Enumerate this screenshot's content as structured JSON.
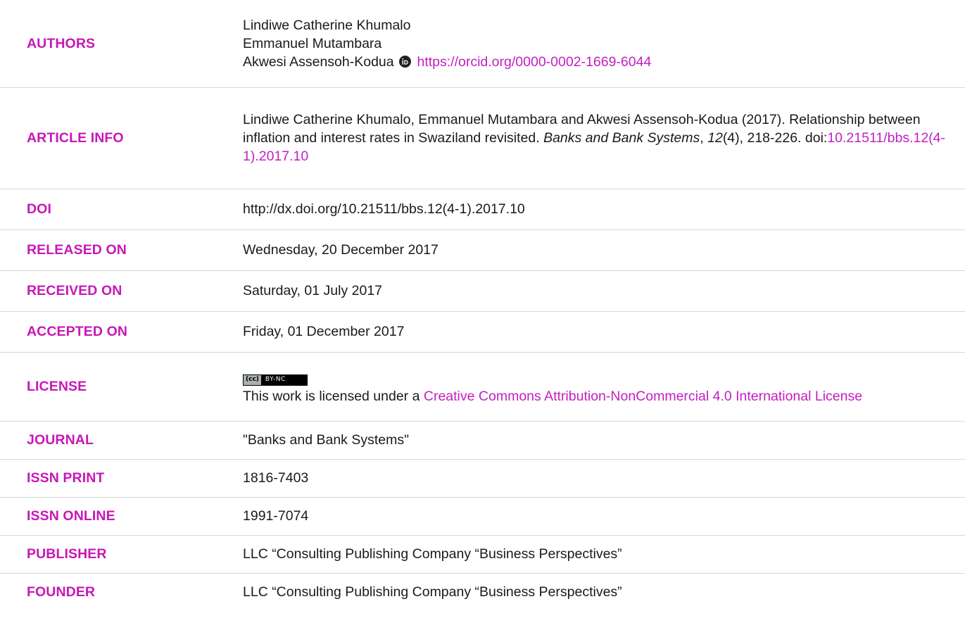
{
  "rows": {
    "authors": {
      "label": "AUTHORS",
      "names": [
        "Lindiwe Catherine Khumalo",
        "Emmanuel Mutambara",
        "Akwesi Assensoh-Kodua"
      ],
      "orcid_url": "https://orcid.org/0000-0002-1669-6044"
    },
    "article_info": {
      "label": "ARTICLE INFO",
      "citation_prefix": "Lindiwe Catherine Khumalo, Emmanuel Mutambara and Akwesi Assensoh-Kodua (2017). Relationship between inflation and interest rates in Swaziland revisited. ",
      "journal": "Banks and Bank Systems",
      "sep1": ", ",
      "volume": "12",
      "issue_pages": "(4), 218-226. doi:",
      "doi_link": "10.21511/bbs.12(4-1).2017.10"
    },
    "doi": {
      "label": "DOI",
      "value": "http://dx.doi.org/10.21511/bbs.12(4-1).2017.10"
    },
    "released_on": {
      "label": "RELEASED ON",
      "value": "Wednesday, 20 December 2017"
    },
    "received_on": {
      "label": "RECEIVED ON",
      "value": "Saturday, 01 July 2017"
    },
    "accepted_on": {
      "label": "ACCEPTED ON",
      "value": "Friday, 01 December 2017"
    },
    "license": {
      "label": "LICENSE",
      "badge_left": "(cc)",
      "badge_right": "BY-NC",
      "text_prefix": "This work is licensed under a ",
      "link_text": "Creative Commons Attribution-NonCommercial 4.0 International License"
    },
    "journal": {
      "label": "JOURNAL",
      "value": "\"Banks and Bank Systems\""
    },
    "issn_print": {
      "label": "ISSN PRINT",
      "value": "1816-7403"
    },
    "issn_online": {
      "label": "ISSN ONLINE",
      "value": "1991-7074"
    },
    "publisher": {
      "label": "PUBLISHER",
      "value": "LLC “Consulting Publishing Company “Business Perspectives”"
    },
    "founder": {
      "label": "FOUNDER",
      "value": "LLC “Consulting Publishing Company “Business Perspectives”"
    }
  },
  "colors": {
    "label": "#c817b7",
    "link": "#c21fc1",
    "text": "#1a1a1a",
    "divider": "#d6d6d6",
    "orcid_green": "#222222"
  },
  "icons": {
    "orcid": "orcid-id-icon",
    "license_badge": "cc-by-nc-badge"
  }
}
